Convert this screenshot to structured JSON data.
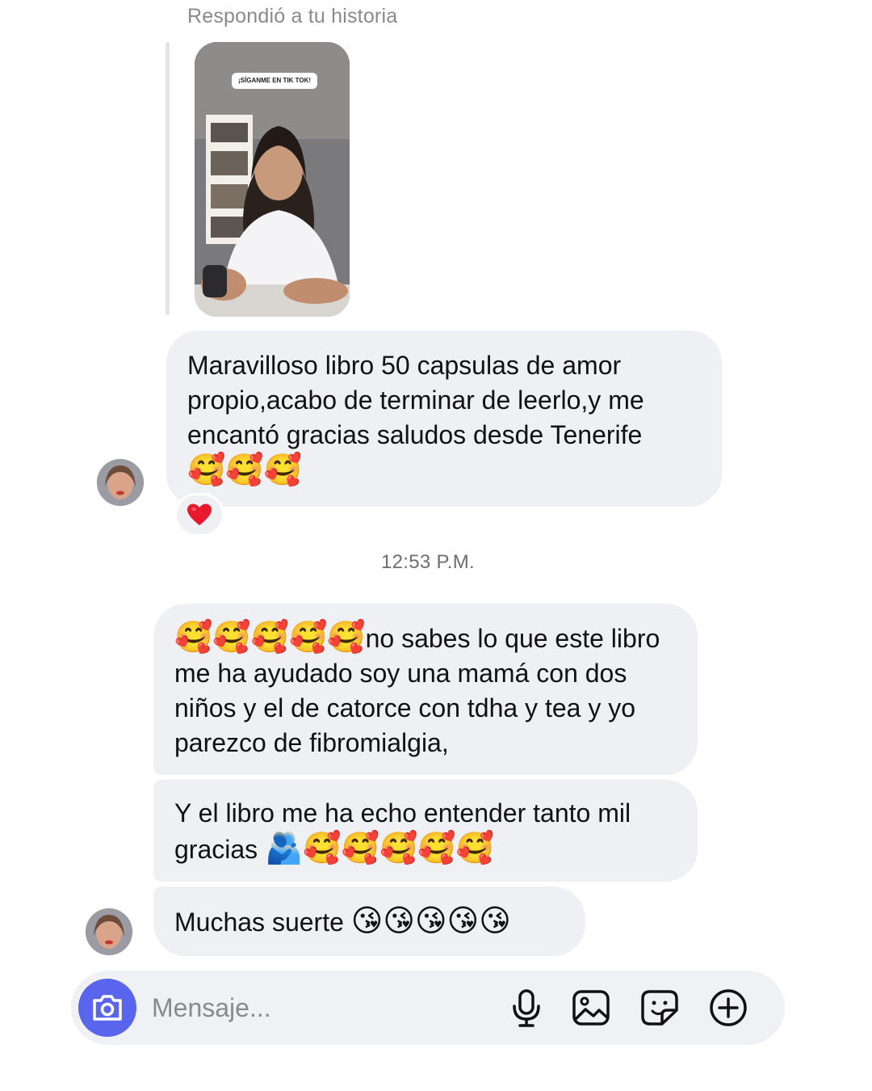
{
  "story_reply": {
    "label": "Respondió a tu historia",
    "sticker_text": "¡SÍGANME EN TIK TOK!"
  },
  "messages": [
    {
      "text": "Maravilloso libro 50 capsulas de amor propio,acabo de terminar de leerlo,y me encantó gracias saludos desde Tenerife",
      "emojis": "🥰🥰🥰",
      "reaction": "❤️"
    },
    {
      "emojis": "🥰🥰🥰🥰🥰",
      "text": "no sabes lo que este libro me ha ayudado soy una mamá con dos niños y el de catorce con tdha y tea y yo parezco de fibromialgia,"
    },
    {
      "text": "Y el libro me ha echo entender tanto mil gracias",
      "emojis": "🫂🥰🥰🥰🥰🥰"
    },
    {
      "text": "Muchas suerte",
      "emojis": "😘😘😘😘😘"
    }
  ],
  "timestamp": "12:53 P.M.",
  "composer": {
    "placeholder": "Mensaje...",
    "camera_icon": "camera-icon",
    "mic_icon": "microphone-icon",
    "gallery_icon": "image-icon",
    "sticker_icon": "sticker-icon",
    "plus_icon": "plus-circle-icon"
  },
  "colors": {
    "bubble": "#eff0f3",
    "accent": "#5865ec",
    "muted_text": "#8a8a8e",
    "heart": "#e8192c"
  }
}
